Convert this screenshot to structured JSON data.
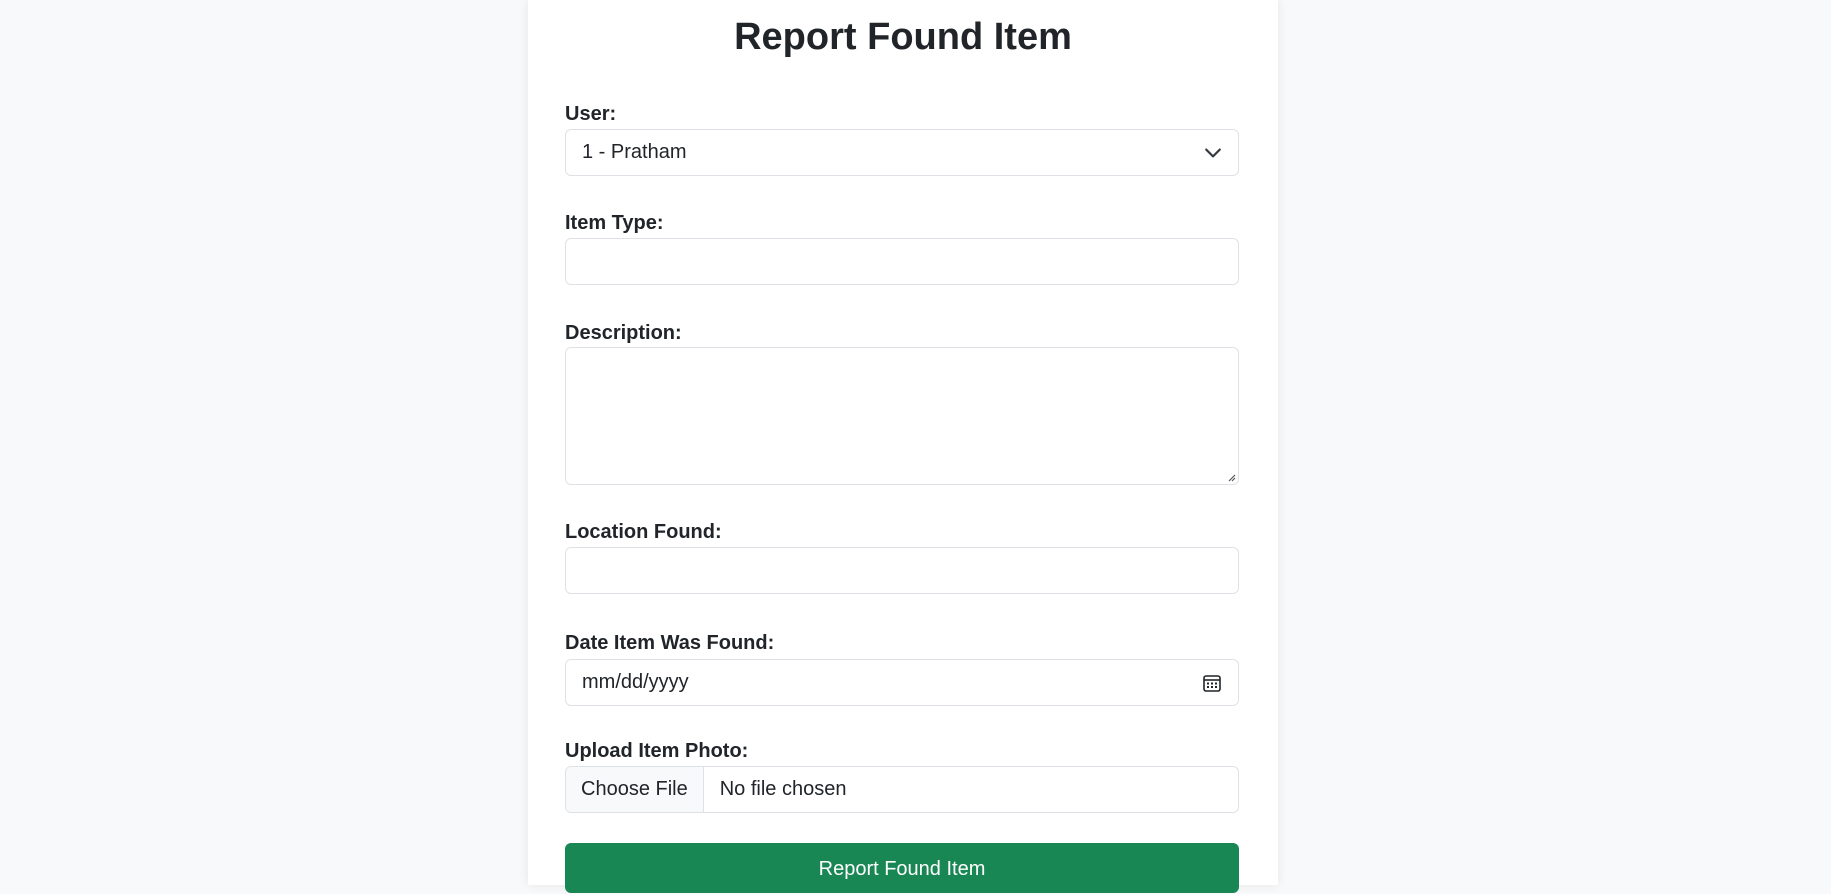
{
  "form": {
    "title": "Report Found Item",
    "user": {
      "label": "User:",
      "selected": "1 - Pratham"
    },
    "item_type": {
      "label": "Item Type:",
      "value": ""
    },
    "description": {
      "label": "Description:",
      "value": ""
    },
    "location": {
      "label": "Location Found:",
      "value": ""
    },
    "date": {
      "label": "Date Item Was Found:",
      "placeholder": "mm/dd/yyyy"
    },
    "photo": {
      "label": "Upload Item Photo:",
      "button_label": "Choose File",
      "status": "No file chosen"
    },
    "submit_label": "Report Found Item"
  },
  "colors": {
    "background": "#f8f9fa",
    "card": "#ffffff",
    "border": "#dee2e6",
    "primary_button": "#198754",
    "text": "#212529"
  },
  "icons": {
    "select": "chevron-down-icon",
    "date": "calendar-icon",
    "textarea": "resize-grip-icon"
  }
}
